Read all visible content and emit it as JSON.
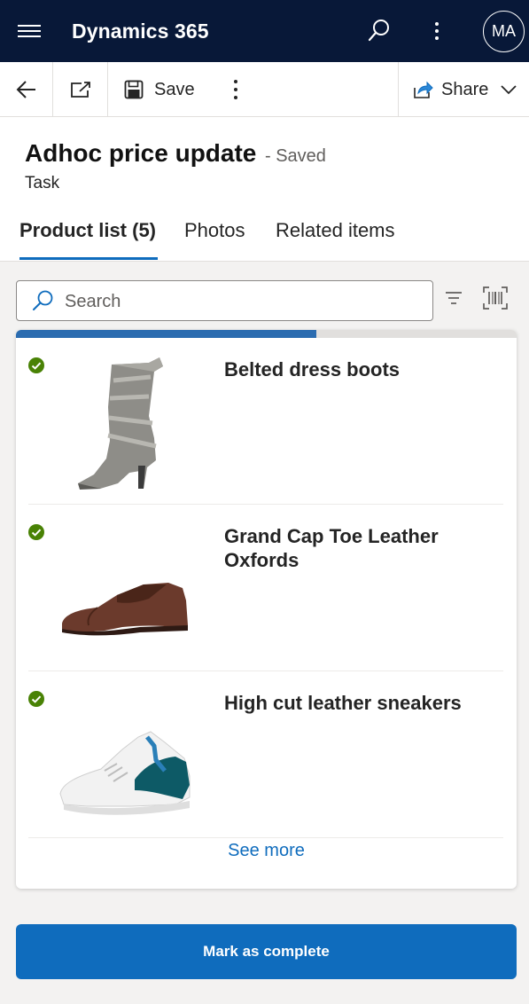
{
  "app": {
    "title": "Dynamics 365",
    "user_initials": "MA"
  },
  "commands": {
    "save_label": "Save",
    "share_label": "Share"
  },
  "record": {
    "title": "Adhoc price update",
    "status": "- Saved",
    "type": "Task"
  },
  "tabs": [
    {
      "label": "Product list (5)",
      "active": true
    },
    {
      "label": "Photos",
      "active": false
    },
    {
      "label": "Related items",
      "active": false
    }
  ],
  "search": {
    "placeholder": "Search"
  },
  "progress": {
    "fraction": 0.6
  },
  "products": [
    {
      "name": "Belted dress boots",
      "completed": true,
      "image": "grey-boot"
    },
    {
      "name": "Grand Cap Toe Leather Oxfords",
      "completed": true,
      "image": "brown-oxford"
    },
    {
      "name": "High cut leather sneakers",
      "completed": true,
      "image": "teal-sneaker"
    }
  ],
  "see_more_label": "See more",
  "complete_button_label": "Mark as complete",
  "colors": {
    "topbar": "#081838",
    "accent": "#0f6cbd",
    "check": "#498205"
  }
}
